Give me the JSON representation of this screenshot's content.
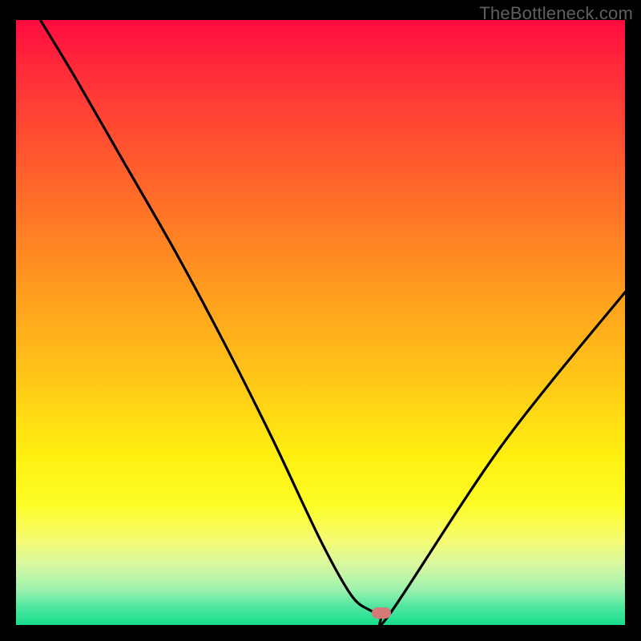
{
  "watermark": "TheBottleneck.com",
  "colors": {
    "background": "#000000",
    "watermark_text": "#5f5f5f",
    "curve": "#000000",
    "marker": "#d47a77",
    "gradient_top": "#ff0b3f",
    "gradient_bottom": "#18dd8d"
  },
  "chart_data": {
    "type": "line",
    "title": "",
    "xlabel": "",
    "ylabel": "",
    "xlim": [
      0,
      100
    ],
    "ylim": [
      0,
      100
    ],
    "grid": false,
    "background": "rainbow-gradient-vertical",
    "series": [
      {
        "name": "bottleneck-curve",
        "x": [
          4,
          10,
          18,
          26,
          34,
          42,
          50,
          55,
          58,
          60,
          61.5,
          80,
          100
        ],
        "values": [
          100,
          90,
          76,
          62,
          47,
          31,
          14,
          5,
          2.5,
          2,
          2,
          30,
          55
        ]
      }
    ],
    "marker": {
      "x": 60,
      "y": 2,
      "color": "#d47a77",
      "shape": "rounded-rect"
    },
    "legend": null
  }
}
